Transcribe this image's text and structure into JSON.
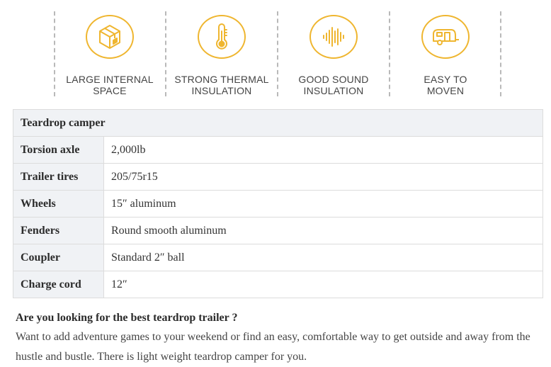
{
  "features": [
    {
      "icon": "box-icon",
      "line1": "LARGE INTERNAL",
      "line2": "SPACE"
    },
    {
      "icon": "thermometer-icon",
      "line1": "STRONG THERMAL",
      "line2": "INSULATION"
    },
    {
      "icon": "sound-wave-icon",
      "line1": "GOOD SOUND",
      "line2": "INSULATION"
    },
    {
      "icon": "trailer-icon",
      "line1": "EASY TO",
      "line2": "MOVEN"
    }
  ],
  "colors": {
    "accent": "#efb630",
    "table_header_bg": "#f0f2f5",
    "border": "#dcdcdc"
  },
  "table": {
    "title": "Teardrop camper",
    "rows": [
      {
        "key": "Torsion axle",
        "value": "2,000lb"
      },
      {
        "key": "Trailer tires",
        "value": "205/75r15"
      },
      {
        "key": "Wheels",
        "value": "15″ aluminum"
      },
      {
        "key": "Fenders",
        "value": "Round smooth aluminum"
      },
      {
        "key": "Coupler",
        "value": "Standard 2″ ball"
      },
      {
        "key": "Charge cord",
        "value": "12″"
      }
    ]
  },
  "description": {
    "heading": "Are  you looking for the best teardrop trailer ?",
    "body": "Want to add adventure games to your weekend or find an easy, comfortable way to get outside and away from the hustle and bustle. There is light weight teardrop camper for you."
  }
}
